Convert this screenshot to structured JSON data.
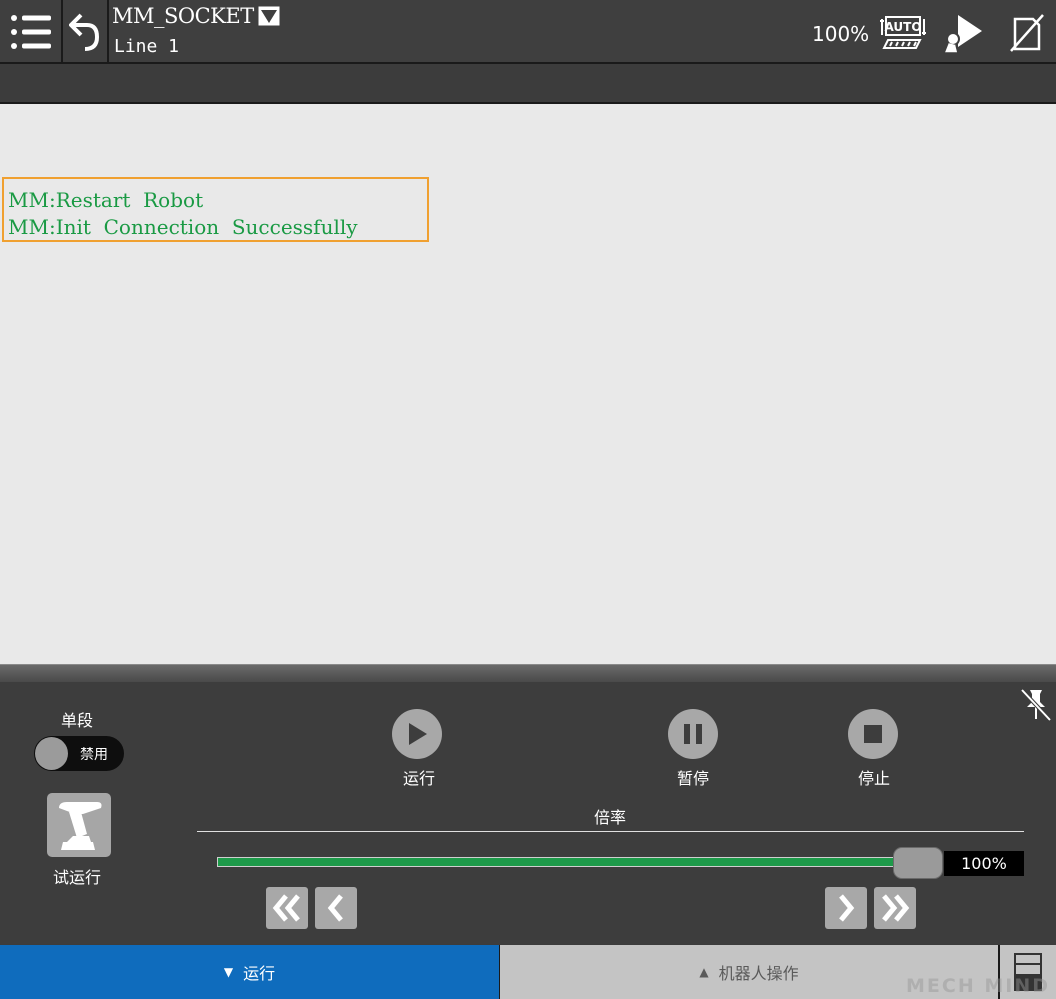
{
  "header": {
    "program_name": "MM_SOCKET",
    "current_line": "Line 1",
    "speed_override": "100%",
    "icons": [
      "menu-icon",
      "back-arrow-icon",
      "program-dropdown-icon",
      "auto-mode-icon",
      "robot-run-icon",
      "no-teach-pendant-icon"
    ]
  },
  "log": {
    "lines": [
      "MM:Restart  Robot",
      "MM:Init  Connection  Successfully"
    ]
  },
  "panel": {
    "single_step_label": "单段",
    "single_step_state": "禁用",
    "trial_run_label": "试运行",
    "run_label": "运行",
    "pause_label": "暂停",
    "stop_label": "停止",
    "override_label": "倍率",
    "override_value": "100%",
    "override_fraction": 1.0
  },
  "tabs": {
    "run_tab": "运行",
    "robot_ops_tab": "机器人操作"
  },
  "watermark": "MECH MIND",
  "colors": {
    "log_text": "#1a9a44",
    "log_border": "#f0a030",
    "run_tab_bg": "#0f6cbd",
    "slider_fill": "#1e9a4a"
  }
}
